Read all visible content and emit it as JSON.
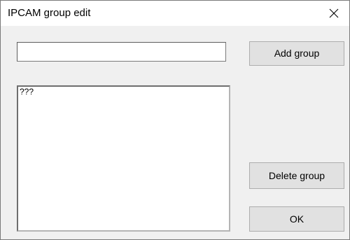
{
  "window": {
    "title": "IPCAM group edit"
  },
  "group_name_input": {
    "value": "",
    "placeholder": ""
  },
  "group_list": {
    "items": [
      "???"
    ]
  },
  "buttons": {
    "add_group": "Add group",
    "delete_group": "Delete group",
    "ok": "OK"
  },
  "icons": {
    "close": "close-icon"
  }
}
